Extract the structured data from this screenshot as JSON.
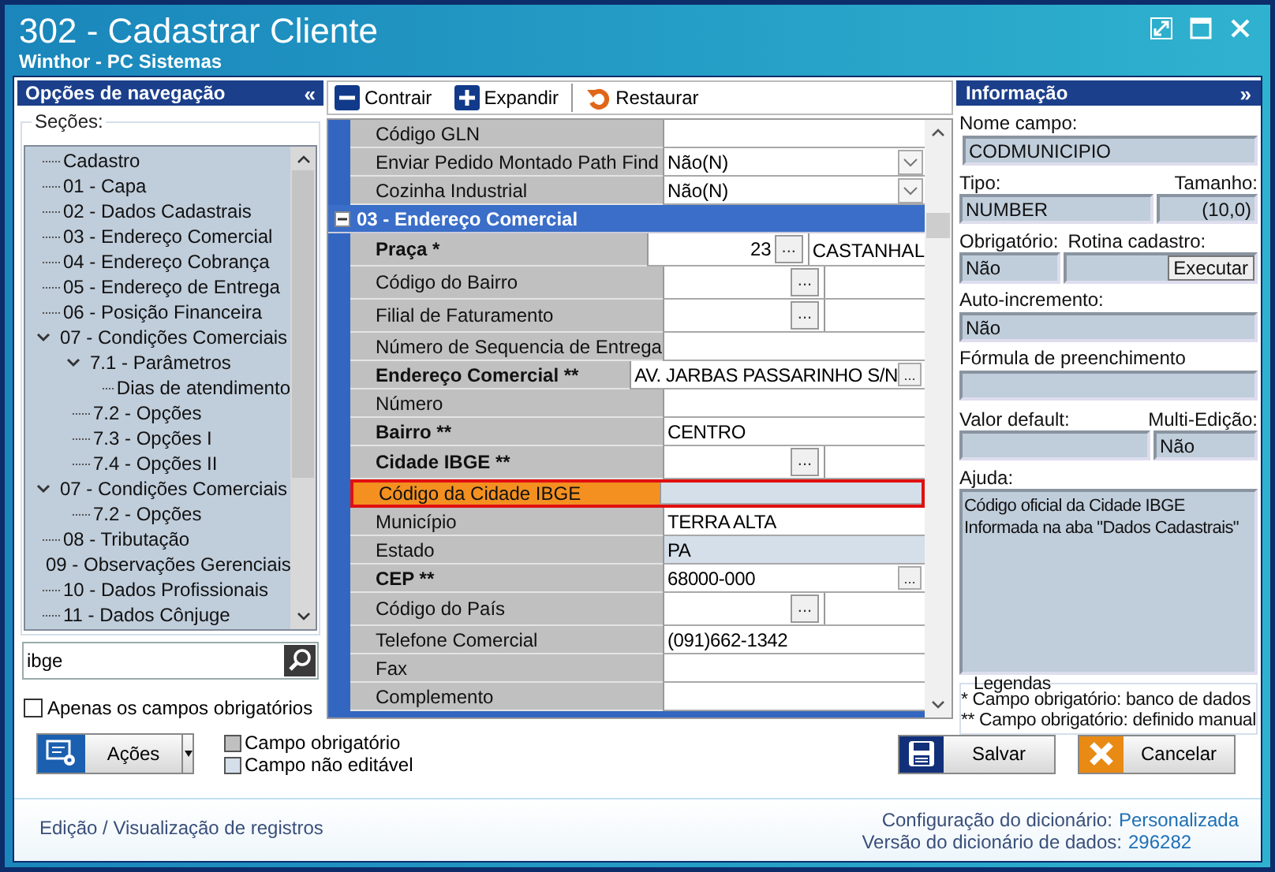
{
  "window": {
    "title": "302 - Cadastrar Cliente",
    "subtitle": "Winthor - PC Sistemas"
  },
  "navigation": {
    "title": "Opções de navegação",
    "collapse": "«",
    "sections_label": "Seções:",
    "tree": [
      {
        "label": "Cadastro"
      },
      {
        "label": "01 - Capa"
      },
      {
        "label": "02 - Dados Cadastrais"
      },
      {
        "label": "03 - Endereço Comercial"
      },
      {
        "label": "04 - Endereço Cobrança"
      },
      {
        "label": "05 - Endereço de Entrega"
      },
      {
        "label": "06 - Posição Financeira"
      },
      {
        "label": "07 - Condições Comerciais",
        "expanded": true,
        "children": [
          {
            "label": "7.1 - Parâmetros",
            "expanded": true,
            "children": [
              {
                "label": "Dias de atendimento"
              }
            ]
          },
          {
            "label": "7.2 - Opções"
          },
          {
            "label": "7.3 - Opções I"
          },
          {
            "label": "7.4 - Opções II"
          }
        ]
      },
      {
        "label": "07 - Condições Comerciais",
        "expanded": true,
        "children": [
          {
            "label": "7.2 - Opções"
          }
        ]
      },
      {
        "label": "08 - Tributação"
      },
      {
        "label": "09 - Observações Gerenciais"
      },
      {
        "label": "10 - Dados Profissionais"
      },
      {
        "label": "11 - Dados Cônjuge"
      }
    ],
    "search": {
      "value": "ibge"
    },
    "only_required": {
      "label": "Apenas os campos obrigatórios",
      "checked": false
    }
  },
  "toolbar": [
    {
      "kind": "collapse",
      "label": "Contrair"
    },
    {
      "kind": "expand",
      "label": "Expandir"
    },
    {
      "kind": "restore",
      "label": "Restaurar"
    }
  ],
  "grid": {
    "rows": [
      {
        "kind": "text",
        "label": "Código GLN",
        "bold": false,
        "readonly": false,
        "selected": false
      },
      {
        "kind": "combo",
        "label": "Enviar Pedido Montado Path Find",
        "value": "Não(N)",
        "bold": false,
        "readonly": false,
        "selected": false
      },
      {
        "kind": "combo",
        "label": "Cozinha Industrial",
        "value": "Não(N)",
        "bold": false,
        "readonly": false,
        "selected": false
      },
      {
        "kind": "section",
        "label": "03 - Endereço Comercial",
        "expanded": true,
        "selected": false
      },
      {
        "kind": "lookup",
        "label": "Praça *",
        "value": "23",
        "button": "...",
        "description": "CASTANHAL",
        "bold": true,
        "readonly": false,
        "selected": false
      },
      {
        "kind": "lookup",
        "label": "Código do Bairro",
        "button": "...",
        "bold": false,
        "readonly": false,
        "selected": false
      },
      {
        "kind": "lookup",
        "label": "Filial de Faturamento",
        "button": "...",
        "bold": false,
        "readonly": false,
        "selected": false
      },
      {
        "kind": "text",
        "label": "Número de Sequencia de Entrega",
        "bold": false,
        "readonly": false,
        "selected": false
      },
      {
        "kind": "ellipsis",
        "label": "Endereço Comercial **",
        "value": "AV. JARBAS PASSARINHO S/N",
        "button": "...",
        "bold": true,
        "readonly": false,
        "selected": false
      },
      {
        "kind": "text",
        "label": "Número",
        "bold": false,
        "readonly": false,
        "selected": false
      },
      {
        "kind": "text",
        "label": "Bairro **",
        "value": "CENTRO",
        "bold": true,
        "readonly": false,
        "selected": false
      },
      {
        "kind": "lookup",
        "label": "Cidade IBGE **",
        "button": "...",
        "bold": true,
        "readonly": false,
        "selected": false
      },
      {
        "kind": "text",
        "label": "Código da Cidade IBGE",
        "bold": false,
        "readonly": true,
        "selected": true
      },
      {
        "kind": "text",
        "label": "Município",
        "value": "TERRA ALTA",
        "bold": false,
        "readonly": false,
        "selected": false
      },
      {
        "kind": "text",
        "label": "Estado",
        "value": "PA",
        "bold": false,
        "readonly": true,
        "selected": false
      },
      {
        "kind": "ellipsis",
        "label": "CEP **",
        "value": "68000-000",
        "button": "...",
        "bold": true,
        "readonly": false,
        "selected": false
      },
      {
        "kind": "lookup",
        "label": "Código do País",
        "button": "...",
        "bold": false,
        "readonly": false,
        "selected": false
      },
      {
        "kind": "text",
        "label": "Telefone Comercial",
        "value": "(091)662-1342",
        "bold": false,
        "readonly": false,
        "selected": false
      },
      {
        "kind": "text",
        "label": "Fax",
        "bold": false,
        "readonly": false,
        "selected": false
      },
      {
        "kind": "text",
        "label": "Complemento",
        "bold": false,
        "readonly": false,
        "selected": false
      }
    ]
  },
  "info": {
    "title": "Informação",
    "collapse": "»",
    "field_name_label": "Nome campo:",
    "field_name": "CODMUNICIPIO",
    "type_label": "Tipo:",
    "size_label": "Tamanho:",
    "type": "NUMBER",
    "size": "(10,0)",
    "required_label": "Obrigatório:",
    "routine_label": "Rotina cadastro:",
    "required": "Não",
    "execute_button": "Executar",
    "autoinc_label": "Auto-incremento:",
    "autoinc": "Não",
    "formula_label": "Fórmula de preenchimento",
    "default_label": "Valor default:",
    "multi_label": "Multi-Edição:",
    "multi": "Não",
    "help_label": "Ajuda:",
    "help": "Código oficial da Cidade IBGE Informada na aba \"Dados Cadastrais\"",
    "legend_title": "Legendas",
    "legend_lines": [
      "* Campo obrigatório: banco de dados",
      "** Campo obrigatório: definido manual"
    ]
  },
  "actions_button": "Ações",
  "legend": [
    {
      "label": "Campo obrigatório",
      "color": "#c0c0c0"
    },
    {
      "label": "Campo não editável",
      "color": "#d5dfea"
    }
  ],
  "buttons": [
    {
      "kind": "save",
      "label": "Salvar"
    },
    {
      "kind": "cancel",
      "label": "Cancelar"
    }
  ],
  "status_bar": {
    "mode": "Edição / Visualização de registros",
    "lines": [
      {
        "label": "Configuração do dicionário:",
        "value": "Personalizada"
      },
      {
        "label": "Versão do dicionário de dados:",
        "value": "296282"
      }
    ]
  }
}
